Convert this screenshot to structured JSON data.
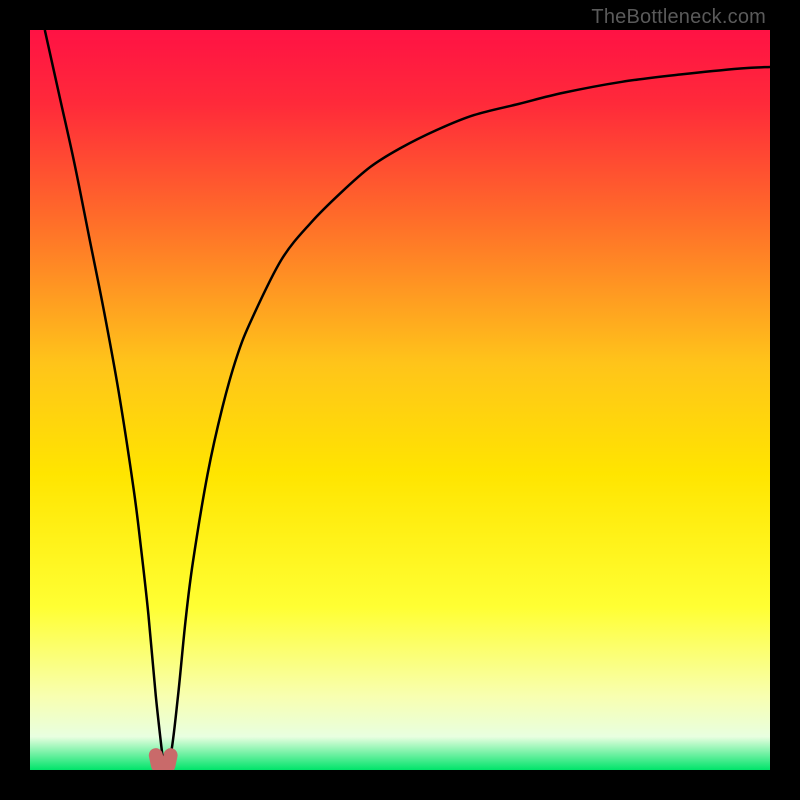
{
  "watermark": {
    "text": "TheBottleneck.com"
  },
  "colors": {
    "black": "#000000",
    "curve": "#000000",
    "marker_fill": "#c96a6a",
    "marker_stroke": "#b45a5a",
    "gradient_stops": [
      {
        "offset": 0.0,
        "color": "#ff1244"
      },
      {
        "offset": 0.1,
        "color": "#ff2a3a"
      },
      {
        "offset": 0.25,
        "color": "#ff6a2a"
      },
      {
        "offset": 0.45,
        "color": "#ffc41a"
      },
      {
        "offset": 0.6,
        "color": "#ffe500"
      },
      {
        "offset": 0.78,
        "color": "#ffff33"
      },
      {
        "offset": 0.9,
        "color": "#f8ffb0"
      },
      {
        "offset": 0.955,
        "color": "#e8ffe0"
      },
      {
        "offset": 1.0,
        "color": "#00e46a"
      }
    ]
  },
  "chart_data": {
    "type": "line",
    "title": "",
    "xlabel": "",
    "ylabel": "",
    "xlim": [
      0,
      100
    ],
    "ylim": [
      0,
      100
    ],
    "x_optimum": 18,
    "series": [
      {
        "name": "bottleneck-curve",
        "x": [
          2,
          4,
          6,
          8,
          10,
          12,
          14,
          15,
          16,
          17,
          18,
          19,
          20,
          21,
          22,
          24,
          26,
          28,
          30,
          34,
          38,
          42,
          46,
          50,
          55,
          60,
          66,
          72,
          80,
          88,
          96,
          100
        ],
        "values": [
          100,
          91,
          82,
          72,
          62,
          51,
          38,
          30,
          21,
          10,
          1,
          2,
          10,
          20,
          28,
          40,
          49,
          56,
          61,
          69,
          74,
          78,
          81.5,
          84,
          86.5,
          88.5,
          90,
          91.5,
          93,
          94,
          94.8,
          95
        ]
      }
    ],
    "markers": [
      {
        "x": 17.0,
        "y": 2.0
      },
      {
        "x": 19.0,
        "y": 2.0
      }
    ],
    "marker_baseline_y": 0.6
  }
}
